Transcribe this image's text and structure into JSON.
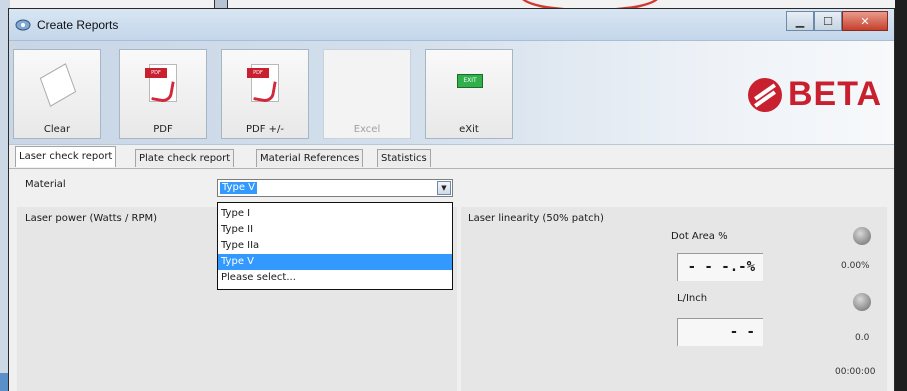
{
  "window": {
    "title": "Create Reports"
  },
  "toolbar": {
    "clear_label": "Clear",
    "pdf_label": "PDF",
    "pdf_pm_label": "PDF +/-",
    "excel_label": "Excel",
    "exit_label": "eXit",
    "pdf_tag_text": "PDF",
    "exit_sign_text": "EXIT"
  },
  "logo": {
    "text": "BETA"
  },
  "tabs": [
    {
      "label": "Laser check report"
    },
    {
      "label": "Plate check report"
    },
    {
      "label": "Material References"
    },
    {
      "label": "Statistics"
    }
  ],
  "material": {
    "label": "Material",
    "selected": "Type V",
    "options": [
      "Type I",
      "Type II",
      "Type IIa",
      "Type V",
      "Please select..."
    ]
  },
  "laser_power": {
    "title": "Laser power (Watts / RPM)"
  },
  "laser_linearity": {
    "title": "Laser linearity (50% patch)",
    "dot_area_label": "Dot Area %",
    "dot_area_value": "- - -.-%",
    "dot_area_small": "0.00%",
    "linch_label": "L/Inch",
    "linch_value": "- -",
    "linch_small": "0.0",
    "time": "00:00:00"
  },
  "colors": {
    "accent": "#3399ff",
    "brand": "#c8202e",
    "exit_green": "#2fb04a"
  }
}
